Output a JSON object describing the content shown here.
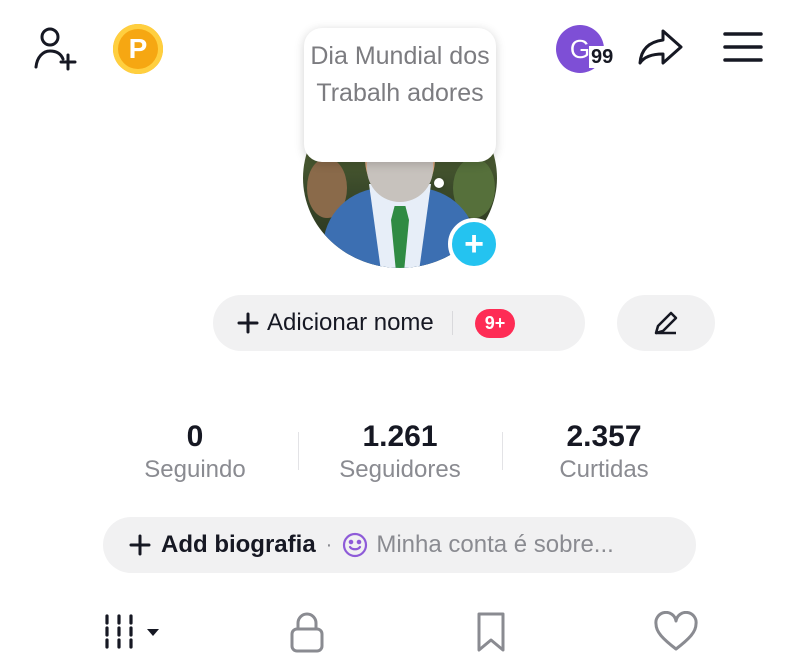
{
  "header": {
    "coin_letter": "P",
    "account_initial": "G",
    "notification_count": "99"
  },
  "note": {
    "text": "Dia Mundial dos Trabalh adores"
  },
  "profile": {
    "add_name_label": "Adicionar nome",
    "badge": "9+"
  },
  "stats": [
    {
      "value": "0",
      "label": "Seguindo"
    },
    {
      "value": "1.261",
      "label": "Seguidores"
    },
    {
      "value": "2.357",
      "label": "Curtidas"
    }
  ],
  "bio": {
    "add_label": "Add biografia",
    "separator": "·",
    "placeholder": "Minha conta é sobre..."
  },
  "tabs": [
    {
      "icon": "grid-icon"
    },
    {
      "icon": "lock-icon"
    },
    {
      "icon": "bookmark-icon"
    },
    {
      "icon": "heart-icon"
    }
  ],
  "colors": {
    "accent_red": "#fe2c55",
    "accent_cyan": "#24c3f0",
    "coin": "#f6a712",
    "avatar_purple": "#7e4fd6"
  }
}
